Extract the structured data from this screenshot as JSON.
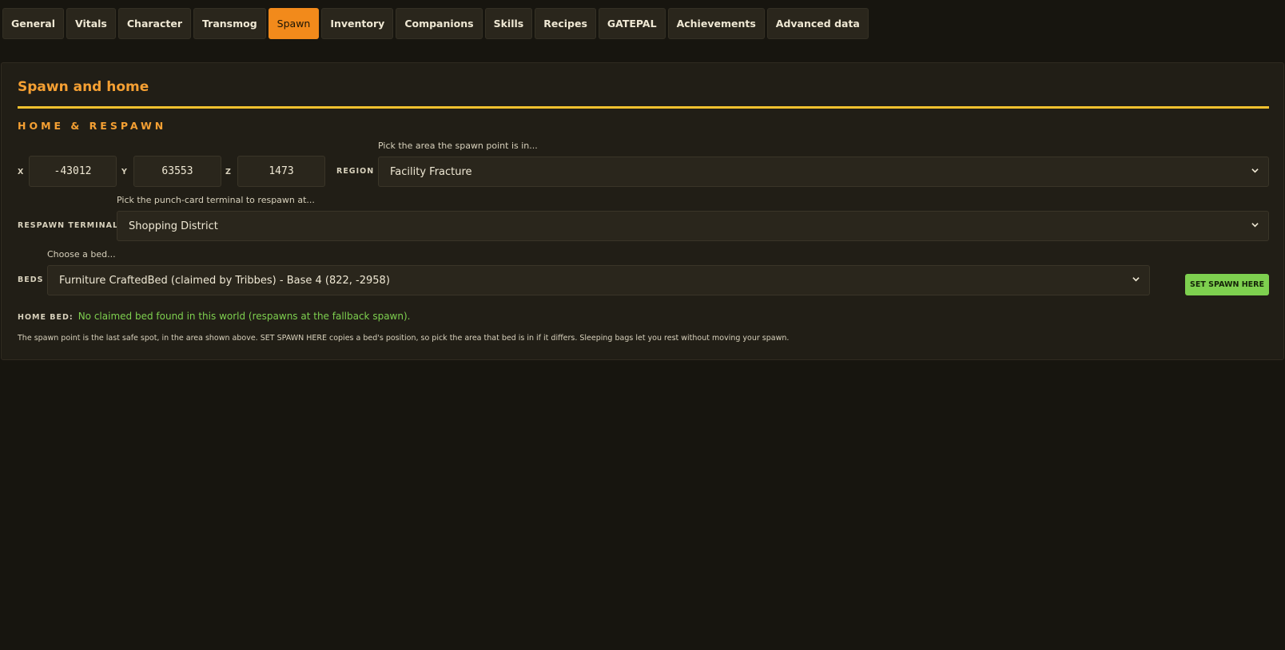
{
  "tabs": [
    {
      "label": "General"
    },
    {
      "label": "Vitals"
    },
    {
      "label": "Character"
    },
    {
      "label": "Transmog"
    },
    {
      "label": "Spawn",
      "active": true
    },
    {
      "label": "Inventory"
    },
    {
      "label": "Companions"
    },
    {
      "label": "Skills"
    },
    {
      "label": "Recipes"
    },
    {
      "label": "GATEPAL"
    },
    {
      "label": "Achievements"
    },
    {
      "label": "Advanced data"
    }
  ],
  "panel": {
    "title": "Spawn and home",
    "section_title": "HOME & RESPAWN"
  },
  "coords": {
    "x_label": "X",
    "x_value": "-43012",
    "y_label": "Y",
    "y_value": "63553",
    "z_label": "Z",
    "z_value": "1473"
  },
  "region": {
    "label": "REGION",
    "hint": "Pick the area the spawn point is in...",
    "value": "Facility Fracture"
  },
  "respawn_terminal": {
    "label": "RESPAWN TERMINAL",
    "hint": "Pick the punch-card terminal to respawn at...",
    "value": "Shopping District"
  },
  "beds": {
    "label": "BEDS",
    "hint": "Choose a bed...",
    "value": "Furniture CraftedBed (claimed by Tribbes) - Base 4 (822, -2958)",
    "button_label": "SET SPAWN HERE"
  },
  "home_bed": {
    "label": "HOME BED:",
    "value": "No claimed bed found in this world (respawns at the fallback spawn)."
  },
  "note": "The spawn point is the last safe spot, in the area shown above. SET SPAWN HERE copies a bed's position, so pick the area that bed is in if it differs. Sleeping bags let you rest without moving your spawn.",
  "colors": {
    "accent": "#f28a1b",
    "heading": "#f5a033",
    "rule": "#f2c12e",
    "success": "#7ed04f",
    "background": "#17150f",
    "panel": "#211e16"
  }
}
